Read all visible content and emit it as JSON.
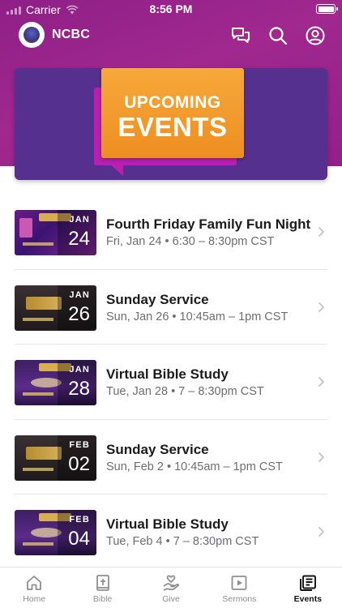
{
  "status_bar": {
    "carrier": "Carrier",
    "time": "8:56 PM"
  },
  "app": {
    "title": "NCBC"
  },
  "appbar_icons": [
    "chat-bubbles-icon",
    "search-icon",
    "profile-icon"
  ],
  "banner": {
    "line1": "UPCOMING",
    "line2": "EVENTS"
  },
  "events": [
    {
      "title": "Fourth Friday Family Fun Night",
      "meta": "Fri, Jan 24 • 6:30 – 8:30pm CST",
      "month": "JAN",
      "day": "24",
      "thumb": "fun"
    },
    {
      "title": "Sunday Service",
      "meta": "Sun, Jan 26 • 10:45am – 1pm CST",
      "month": "JAN",
      "day": "26",
      "thumb": "worship"
    },
    {
      "title": "Virtual Bible Study",
      "meta": "Tue, Jan 28 • 7 – 8:30pm CST",
      "month": "JAN",
      "day": "28",
      "thumb": "bible"
    },
    {
      "title": "Sunday Service",
      "meta": "Sun, Feb 2 • 10:45am – 1pm CST",
      "month": "FEB",
      "day": "02",
      "thumb": "worship"
    },
    {
      "title": "Virtual Bible Study",
      "meta": "Tue, Feb 4 • 7 – 8:30pm CST",
      "month": "FEB",
      "day": "04",
      "thumb": "bible"
    }
  ],
  "tabs": [
    {
      "label": "Home",
      "icon": "home-icon",
      "active": false
    },
    {
      "label": "Bible",
      "icon": "bible-icon",
      "active": false
    },
    {
      "label": "Give",
      "icon": "give-icon",
      "active": false
    },
    {
      "label": "Sermons",
      "icon": "sermons-icon",
      "active": false
    },
    {
      "label": "Events",
      "icon": "events-icon",
      "active": true
    }
  ],
  "colors": {
    "header_purple": "#a0288f",
    "banner_purple": "#56308f",
    "banner_orange": "#f0972a",
    "banner_magenta": "#b81fb2"
  }
}
